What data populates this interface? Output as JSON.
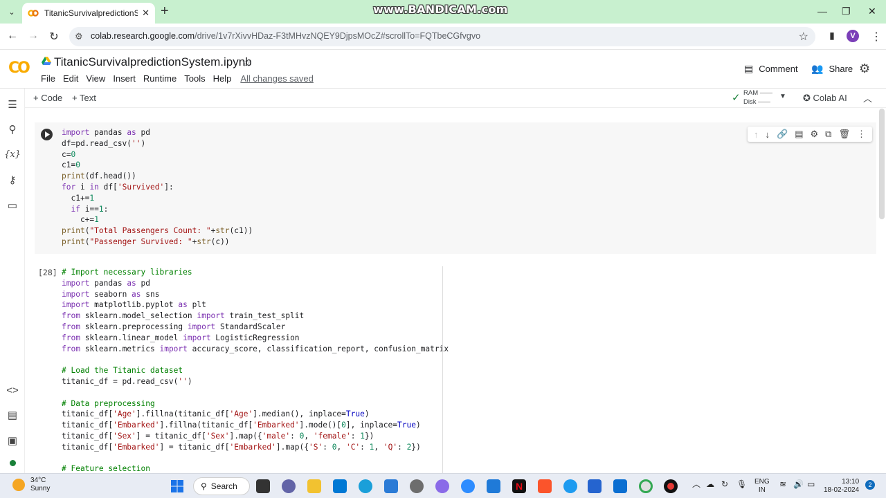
{
  "browser": {
    "tab_title": "TitanicSurvivalpredictionSystem",
    "url_host": "colab.research.google.com",
    "url_path": "/drive/1v7rXivvHDaz-F3tMHvzNQEY9DjpsMOcZ#scrollTo=FQTbeCGfvgvo",
    "profile_initial": "V",
    "watermark": "www.BANDICAM.com"
  },
  "colab": {
    "logo": "CO",
    "notebook_title": "TitanicSurvivalpredictionSystem.ipynb",
    "menu": [
      "File",
      "Edit",
      "View",
      "Insert",
      "Runtime",
      "Tools",
      "Help"
    ],
    "saved_status": "All changes saved",
    "comment_label": "Comment",
    "share_label": "Share",
    "add_code_label": "+ Code",
    "add_text_label": "+ Text",
    "ram_label": "RAM",
    "disk_label": "Disk",
    "colab_ai_label": "Colab AI"
  },
  "cells": [
    {
      "exec_count": "",
      "lines": [
        "import pandas as pd",
        "df=pd.read_csv('')",
        "c=0",
        "c1=0",
        "print(df.head())",
        "for i in df['Survived']:",
        "  c1+=1",
        "  if i==1:",
        "    c+=1",
        "print(\"Total Passengers Count: \"+str(c1))",
        "print(\"Passenger Survived: \"+str(c))"
      ]
    },
    {
      "exec_count": "[28]",
      "lines": [
        "# Import necessary libraries",
        "import pandas as pd",
        "import seaborn as sns",
        "import matplotlib.pyplot as plt",
        "from sklearn.model_selection import train_test_split",
        "from sklearn.preprocessing import StandardScaler",
        "from sklearn.linear_model import LogisticRegression",
        "from sklearn.metrics import accuracy_score, classification_report, confusion_matrix",
        "",
        "# Load the Titanic dataset",
        "titanic_df = pd.read_csv('')",
        "",
        "# Data preprocessing",
        "titanic_df['Age'].fillna(titanic_df['Age'].median(), inplace=True)",
        "titanic_df['Embarked'].fillna(titanic_df['Embarked'].mode()[0], inplace=True)",
        "titanic_df['Sex'] = titanic_df['Sex'].map({'male': 0, 'female': 1})",
        "titanic_df['Embarked'] = titanic_df['Embarked'].map({'S': 0, 'C': 1, 'Q': 2})",
        "",
        "# Feature selection"
      ]
    }
  ],
  "taskbar": {
    "temperature": "34°C",
    "weather": "Sunny",
    "search_label": "Search",
    "lang_top": "ENG",
    "lang_bottom": "IN",
    "time": "13:10",
    "date": "18-02-2024",
    "notif_count": "2"
  }
}
